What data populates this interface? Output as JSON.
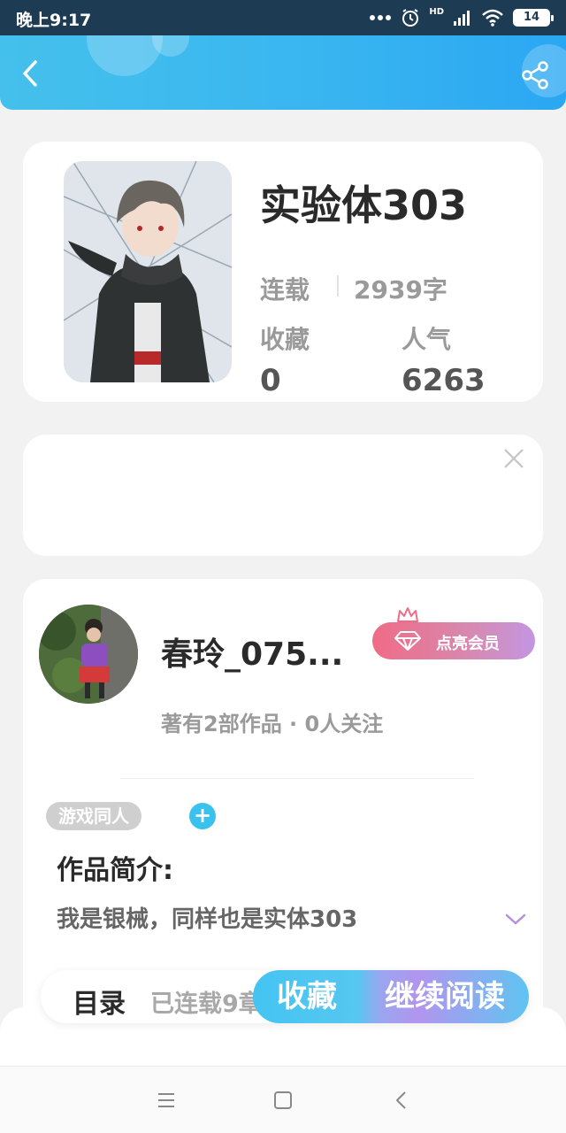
{
  "status_bar": {
    "time": "晚上9:17",
    "battery": "14",
    "network_label": "HD"
  },
  "header": {
    "back_icon": "chevron-left-icon",
    "share_icon": "share-icon"
  },
  "book": {
    "title": "实验体303",
    "status": "连载",
    "word_count": "2939字",
    "favorites_label": "收藏",
    "favorites_value": "0",
    "popularity_label": "人气",
    "popularity_value": "6263"
  },
  "author": {
    "name": "春玲_075...",
    "meta": "著有2部作品 · 0人关注",
    "vip_button": "点亮会员"
  },
  "details": {
    "tag": "游戏同人",
    "tag_add": "+",
    "intro_title": "作品简介:",
    "intro_text": "我是银械，同样也是实体303"
  },
  "bottom_bar": {
    "toc_label": "目录",
    "toc_status": "已连载9章",
    "collect_button": "收藏",
    "continue_button": "继续阅读"
  },
  "colors": {
    "header_gradient_start": "#45c0ec",
    "header_gradient_end": "#2aa7f2",
    "vip_gradient_start": "#f06b86",
    "vip_gradient_end": "#c296e2",
    "accent_blue": "#3ac1ee"
  }
}
